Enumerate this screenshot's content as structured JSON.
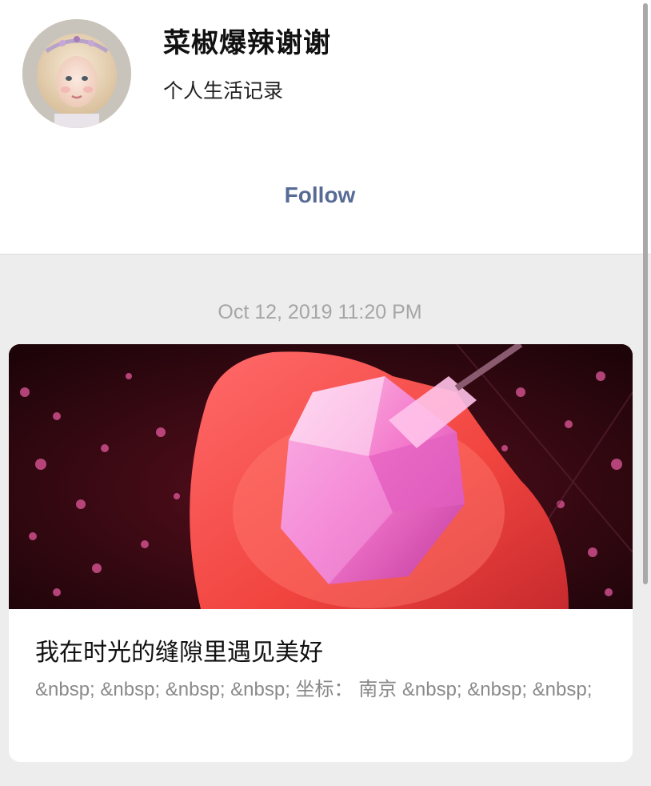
{
  "account": {
    "name": "菜椒爆辣谢谢",
    "description": "个人生活记录",
    "follow_label": "Follow"
  },
  "feed": {
    "timestamp": "Oct 12, 2019 11:20 PM",
    "article": {
      "title": "我在时光的缝隙里遇见美好",
      "digest": "&nbsp; &nbsp; &nbsp; &nbsp; 坐标：  南京 &nbsp; &nbsp; &nbsp;"
    }
  },
  "colors": {
    "link_blue": "#576b95",
    "background": "#ededed",
    "card": "#ffffff",
    "timestamp_gray": "#a6a6a6"
  }
}
